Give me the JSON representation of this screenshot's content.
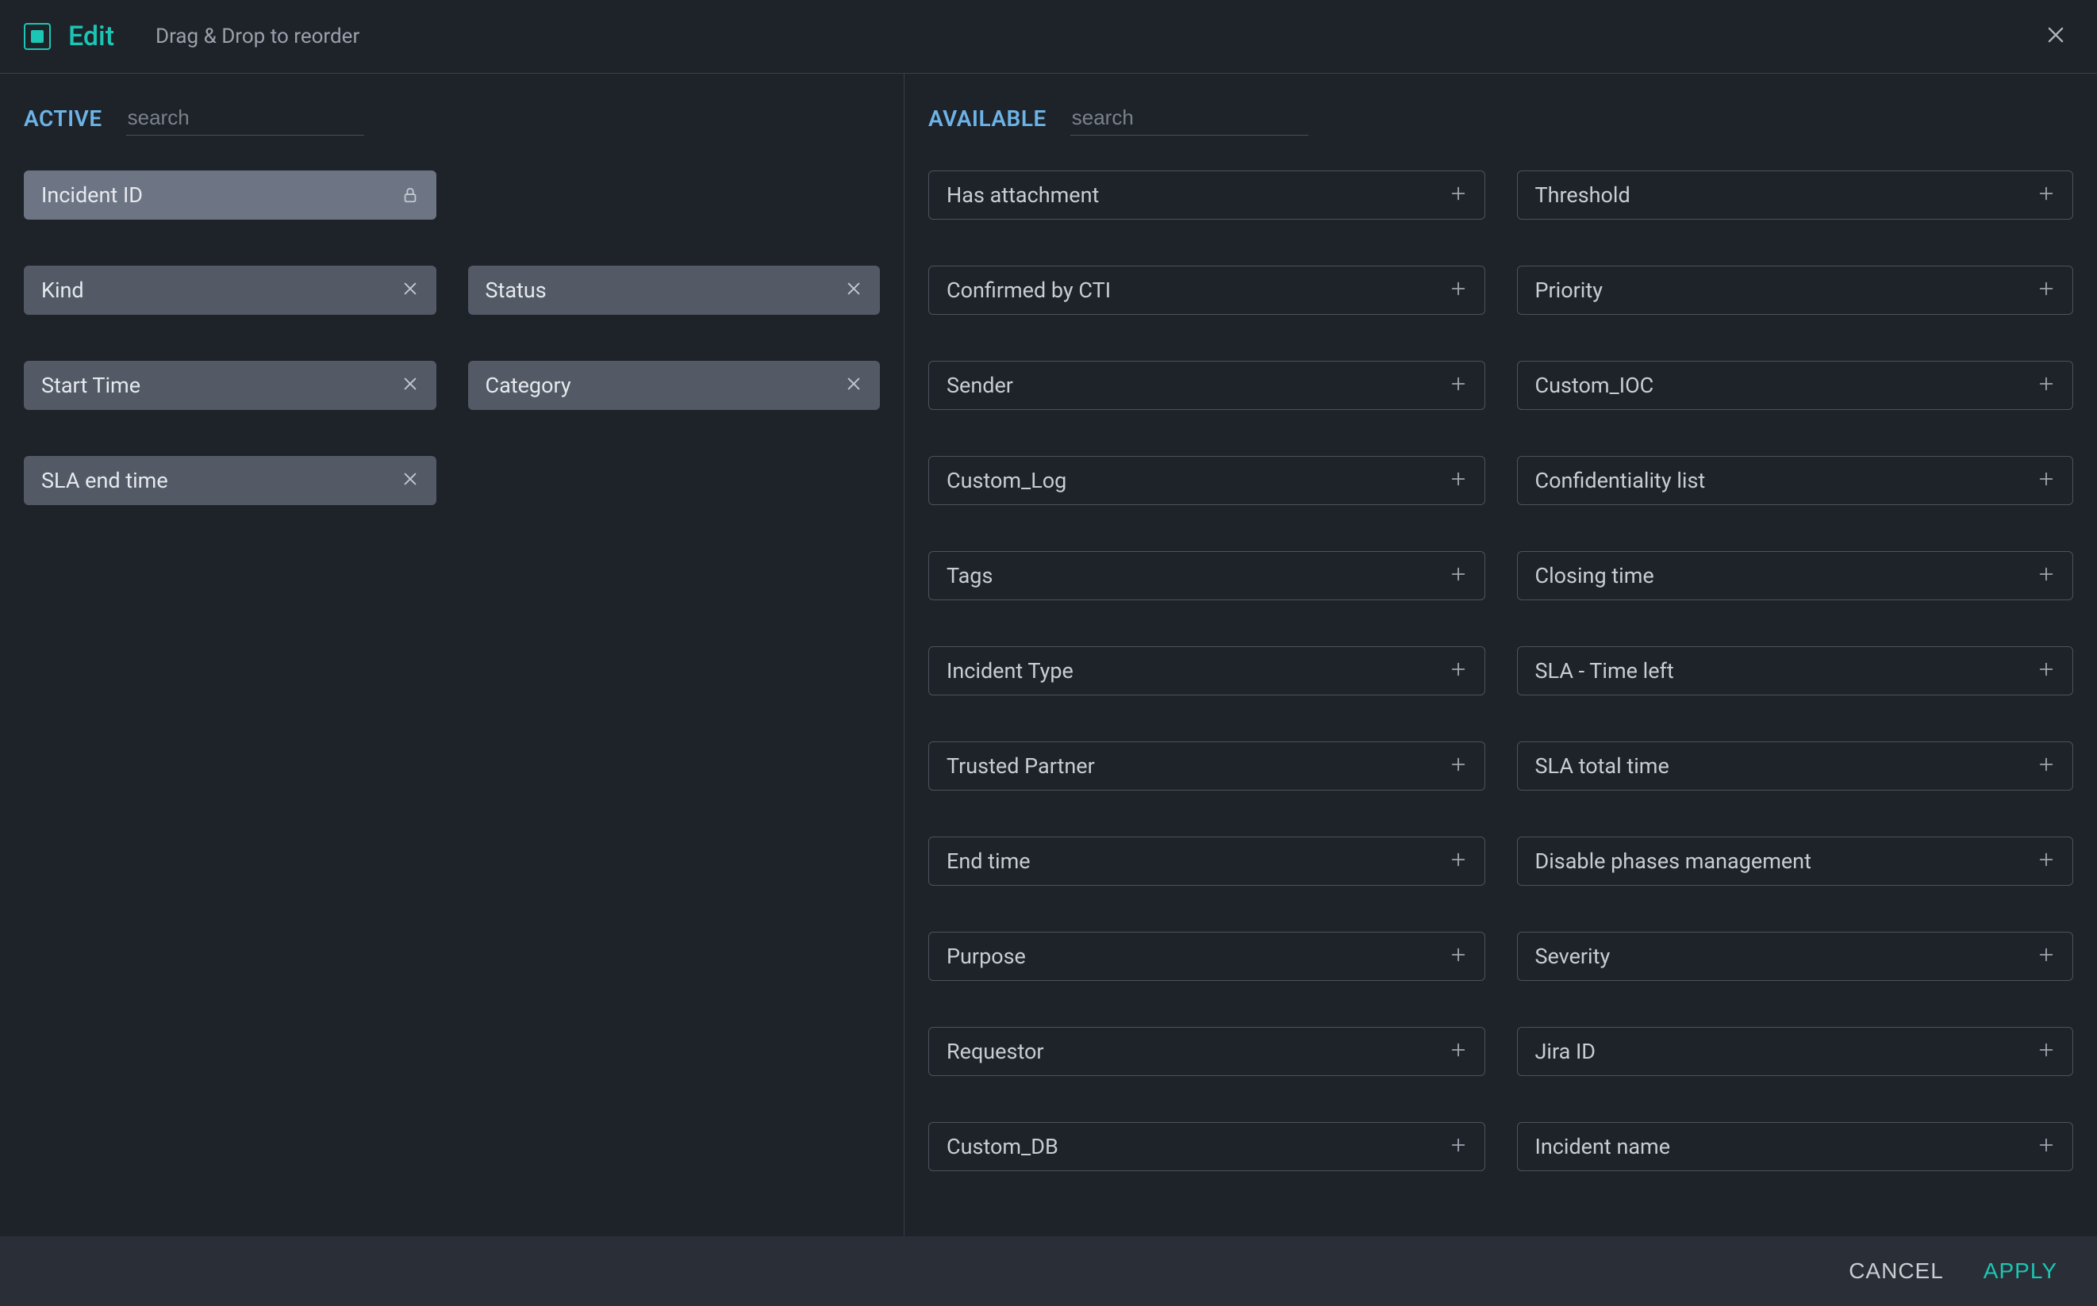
{
  "header": {
    "title": "Edit",
    "subtitle": "Drag & Drop to reorder"
  },
  "panes": {
    "active": {
      "title": "ACTIVE",
      "search_placeholder": "search",
      "items": [
        {
          "label": "Incident ID",
          "locked": true
        },
        {
          "label": "Kind"
        },
        {
          "label": "Status"
        },
        {
          "label": "Start Time"
        },
        {
          "label": "Category"
        },
        {
          "label": "SLA end time"
        }
      ]
    },
    "available": {
      "title": "AVAILABLE",
      "search_placeholder": "search",
      "items": [
        {
          "label": "Has attachment"
        },
        {
          "label": "Threshold"
        },
        {
          "label": "Confirmed by CTI"
        },
        {
          "label": "Priority"
        },
        {
          "label": "Sender"
        },
        {
          "label": "Custom_IOC"
        },
        {
          "label": "Custom_Log"
        },
        {
          "label": "Confidentiality list"
        },
        {
          "label": "Tags"
        },
        {
          "label": "Closing time"
        },
        {
          "label": "Incident Type"
        },
        {
          "label": "SLA - Time left"
        },
        {
          "label": "Trusted Partner"
        },
        {
          "label": "SLA total time"
        },
        {
          "label": "End time"
        },
        {
          "label": "Disable phases management"
        },
        {
          "label": "Purpose"
        },
        {
          "label": "Severity"
        },
        {
          "label": "Requestor"
        },
        {
          "label": "Jira ID"
        },
        {
          "label": "Custom_DB"
        },
        {
          "label": "Incident name"
        }
      ]
    }
  },
  "footer": {
    "cancel": "CANCEL",
    "apply": "APPLY"
  }
}
